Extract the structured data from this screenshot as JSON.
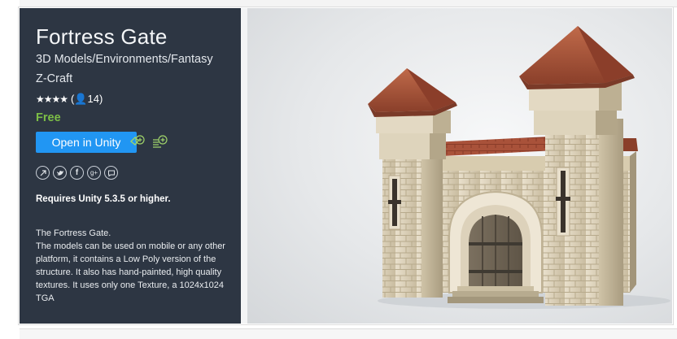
{
  "asset": {
    "title": "Fortress Gate",
    "category": "3D Models/Environments/Fantasy",
    "publisher": "Z-Craft",
    "stars": "★★★★",
    "rating_count": "(👤14)",
    "price": "Free",
    "open_button_label": "Open in Unity",
    "requirement": "Requires Unity 5.3.5 or higher.",
    "description": [
      "The Fortress Gate.",
      "The models can be used on mobile or any other platform, it contains a Low Poly version of the structure. It also has hand-painted, high quality textures. It uses only one Texture, a 1024x1024 TGA"
    ]
  },
  "social_icons": [
    "share-icon",
    "twitter-icon",
    "facebook-icon",
    "google-plus-icon",
    "comment-icon"
  ],
  "action_icons": [
    "add-to-wishlist-icon",
    "add-to-list-icon"
  ],
  "colors": {
    "sidebar_bg": "#2d3643",
    "accent_blue": "#2196f3",
    "price_green": "#7cbe46"
  }
}
